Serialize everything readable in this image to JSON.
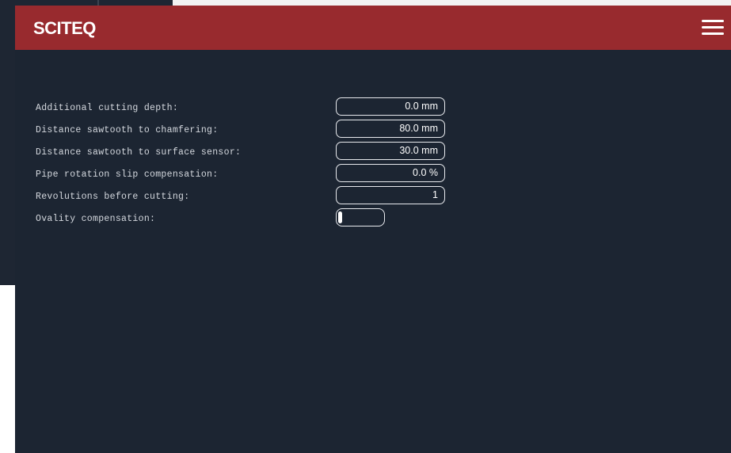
{
  "header": {
    "logo_text": "SCITEQ",
    "menu_icon": "hamburger-menu-icon",
    "background_color": "#982a2e"
  },
  "colors": {
    "app_background": "#1c2532",
    "text": "#d4d8de",
    "field_border": "#e8eaee"
  },
  "settings": [
    {
      "label": "Additional cutting depth:",
      "value": "0.0 mm"
    },
    {
      "label": "Distance sawtooth to chamfering:",
      "value": "80.0 mm"
    },
    {
      "label": "Distance sawtooth to surface sensor:",
      "value": "30.0 mm"
    },
    {
      "label": "Pipe rotation slip compensation:",
      "value": "0.0 %"
    },
    {
      "label": "Revolutions before cutting:",
      "value": "1"
    },
    {
      "label": "Ovality compensation:",
      "toggle_state": "off"
    }
  ]
}
